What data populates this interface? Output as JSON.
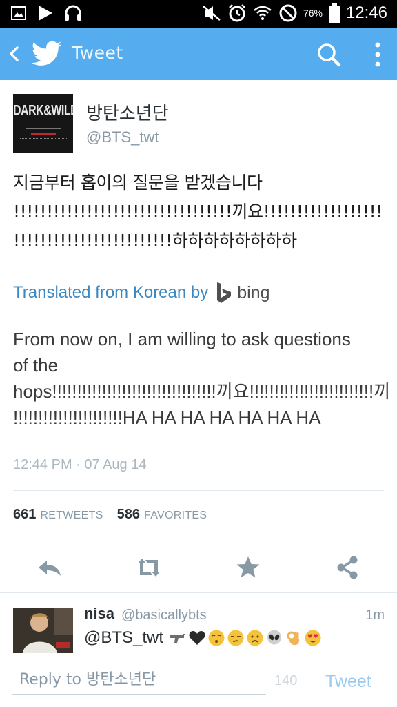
{
  "status_bar": {
    "battery_pct": "76%",
    "time": "12:46",
    "icons": [
      "image-icon",
      "play-icon",
      "headphones-icon",
      "mute-icon",
      "alarm-icon",
      "wifi-icon",
      "blocked-icon",
      "battery-icon"
    ]
  },
  "app_bar": {
    "title": "Tweet",
    "color": "#55acee",
    "icons": [
      "back-icon",
      "twitter-bird-icon",
      "search-icon",
      "more-vert-icon"
    ]
  },
  "tweet": {
    "author_name": "방탄소년단",
    "author_handle": "@BTS_twt",
    "avatar_text": "DARK&WILD",
    "text_lines": [
      "지금부터 홉이의 질문을 받겠습니다",
      "!!!!!!!!!!!!!!!!!!!!!!!!!!!!!!!!!끼요!!!!!!!!!!!!!!!!!!!!!!!!!끼야!!!!",
      "!!!!!!!!!!!!!!!!!!!!!!!!하하하하하하하하"
    ],
    "translated_prefix": "Translated from Korean by",
    "translator": "bing",
    "translation_lines": [
      "From now on, I am willing to ask questions",
      "of the",
      "hops!!!!!!!!!!!!!!!!!!!!!!!!!!!!!!!!!끼요!!!!!!!!!!!!!!!!!!!!!!!!!끼야!!!!!!",
      "!!!!!!!!!!!!!!!!!!!!!!HA HA HA HA HA HA HA"
    ],
    "timestamp": "12:44 PM · 07 Aug 14",
    "retweets_count": "661",
    "retweets_label": "RETWEETS",
    "favorites_count": "586",
    "favorites_label": "FAVORITES",
    "action_icons": [
      "reply-icon",
      "retweet-icon",
      "favorite-star-icon",
      "share-icon"
    ]
  },
  "reply": {
    "name": "nisa",
    "handle": "@basicallybts",
    "time": "1m",
    "text": "@BTS_twt",
    "emoji_icons": [
      "gun-icon",
      "black-heart-icon",
      "kissing-face-icon",
      "unamused-face-icon",
      "worried-face-icon",
      "alien-icon",
      "ok-hand-icon",
      "heart-eyes-icon"
    ]
  },
  "composer": {
    "placeholder": "Reply to 방탄소년단",
    "char_count": "140",
    "tweet_label": "Tweet"
  }
}
